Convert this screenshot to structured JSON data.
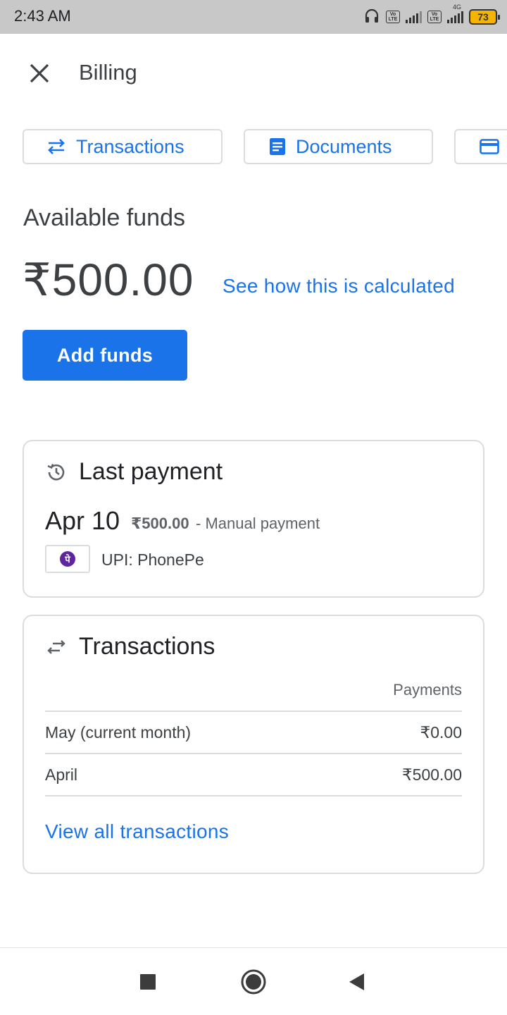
{
  "status_bar": {
    "time": "2:43 AM",
    "network_label": "4G",
    "sim_label": "Vo LTE",
    "battery": "73"
  },
  "header": {
    "title": "Billing",
    "close_icon": "close-icon"
  },
  "chips": [
    {
      "label": "Transactions",
      "icon": "swap-arrows-icon"
    },
    {
      "label": "Documents",
      "icon": "document-icon"
    },
    {
      "label": "",
      "icon": "credit-card-icon"
    }
  ],
  "funds": {
    "label": "Available funds",
    "amount": "₹500.00",
    "calc_link": "See how this is calculated",
    "add_button": "Add funds"
  },
  "last_payment": {
    "title": "Last payment",
    "icon": "history-icon",
    "date": "Apr 10",
    "amount": "₹500.00",
    "description": "- Manual payment",
    "method_logo_letter": "पे",
    "method": "UPI: PhonePe"
  },
  "transactions": {
    "title": "Transactions",
    "icon": "swap-arrows-icon",
    "column_header": "Payments",
    "rows": [
      {
        "period": "May (current month)",
        "amount": "₹0.00"
      },
      {
        "period": "April",
        "amount": "₹500.00"
      }
    ],
    "view_all": "View all transactions"
  },
  "nav": {
    "recent": "recent-apps-icon",
    "home": "home-icon",
    "back": "back-icon"
  },
  "colors": {
    "accent": "#1a73e8",
    "border": "#dadce0",
    "text": "#202124",
    "secondary_text": "#5f6368",
    "phonepe": "#5f259f",
    "battery": "#f4b400"
  }
}
